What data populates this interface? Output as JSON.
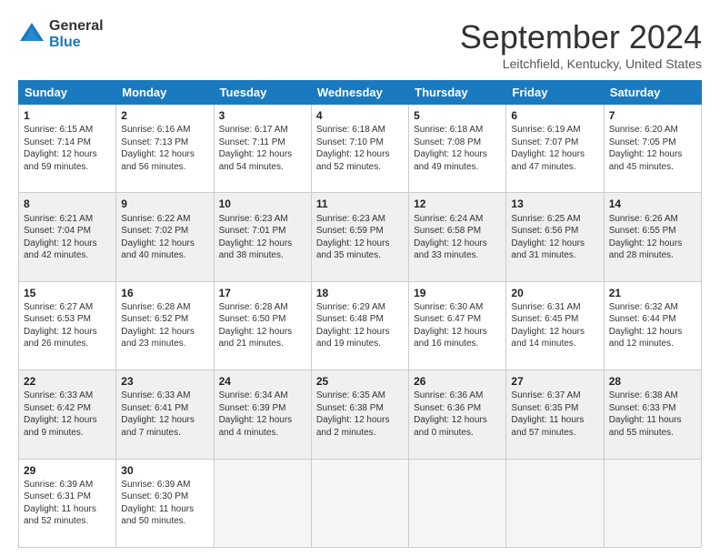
{
  "logo": {
    "line1": "General",
    "line2": "Blue"
  },
  "title": "September 2024",
  "location": "Leitchfield, Kentucky, United States",
  "headers": [
    "Sunday",
    "Monday",
    "Tuesday",
    "Wednesday",
    "Thursday",
    "Friday",
    "Saturday"
  ],
  "weeks": [
    [
      {
        "day": "1",
        "info": "Sunrise: 6:15 AM\nSunset: 7:14 PM\nDaylight: 12 hours\nand 59 minutes."
      },
      {
        "day": "2",
        "info": "Sunrise: 6:16 AM\nSunset: 7:13 PM\nDaylight: 12 hours\nand 56 minutes."
      },
      {
        "day": "3",
        "info": "Sunrise: 6:17 AM\nSunset: 7:11 PM\nDaylight: 12 hours\nand 54 minutes."
      },
      {
        "day": "4",
        "info": "Sunrise: 6:18 AM\nSunset: 7:10 PM\nDaylight: 12 hours\nand 52 minutes."
      },
      {
        "day": "5",
        "info": "Sunrise: 6:18 AM\nSunset: 7:08 PM\nDaylight: 12 hours\nand 49 minutes."
      },
      {
        "day": "6",
        "info": "Sunrise: 6:19 AM\nSunset: 7:07 PM\nDaylight: 12 hours\nand 47 minutes."
      },
      {
        "day": "7",
        "info": "Sunrise: 6:20 AM\nSunset: 7:05 PM\nDaylight: 12 hours\nand 45 minutes."
      }
    ],
    [
      {
        "day": "8",
        "info": "Sunrise: 6:21 AM\nSunset: 7:04 PM\nDaylight: 12 hours\nand 42 minutes."
      },
      {
        "day": "9",
        "info": "Sunrise: 6:22 AM\nSunset: 7:02 PM\nDaylight: 12 hours\nand 40 minutes."
      },
      {
        "day": "10",
        "info": "Sunrise: 6:23 AM\nSunset: 7:01 PM\nDaylight: 12 hours\nand 38 minutes."
      },
      {
        "day": "11",
        "info": "Sunrise: 6:23 AM\nSunset: 6:59 PM\nDaylight: 12 hours\nand 35 minutes."
      },
      {
        "day": "12",
        "info": "Sunrise: 6:24 AM\nSunset: 6:58 PM\nDaylight: 12 hours\nand 33 minutes."
      },
      {
        "day": "13",
        "info": "Sunrise: 6:25 AM\nSunset: 6:56 PM\nDaylight: 12 hours\nand 31 minutes."
      },
      {
        "day": "14",
        "info": "Sunrise: 6:26 AM\nSunset: 6:55 PM\nDaylight: 12 hours\nand 28 minutes."
      }
    ],
    [
      {
        "day": "15",
        "info": "Sunrise: 6:27 AM\nSunset: 6:53 PM\nDaylight: 12 hours\nand 26 minutes."
      },
      {
        "day": "16",
        "info": "Sunrise: 6:28 AM\nSunset: 6:52 PM\nDaylight: 12 hours\nand 23 minutes."
      },
      {
        "day": "17",
        "info": "Sunrise: 6:28 AM\nSunset: 6:50 PM\nDaylight: 12 hours\nand 21 minutes."
      },
      {
        "day": "18",
        "info": "Sunrise: 6:29 AM\nSunset: 6:48 PM\nDaylight: 12 hours\nand 19 minutes."
      },
      {
        "day": "19",
        "info": "Sunrise: 6:30 AM\nSunset: 6:47 PM\nDaylight: 12 hours\nand 16 minutes."
      },
      {
        "day": "20",
        "info": "Sunrise: 6:31 AM\nSunset: 6:45 PM\nDaylight: 12 hours\nand 14 minutes."
      },
      {
        "day": "21",
        "info": "Sunrise: 6:32 AM\nSunset: 6:44 PM\nDaylight: 12 hours\nand 12 minutes."
      }
    ],
    [
      {
        "day": "22",
        "info": "Sunrise: 6:33 AM\nSunset: 6:42 PM\nDaylight: 12 hours\nand 9 minutes."
      },
      {
        "day": "23",
        "info": "Sunrise: 6:33 AM\nSunset: 6:41 PM\nDaylight: 12 hours\nand 7 minutes."
      },
      {
        "day": "24",
        "info": "Sunrise: 6:34 AM\nSunset: 6:39 PM\nDaylight: 12 hours\nand 4 minutes."
      },
      {
        "day": "25",
        "info": "Sunrise: 6:35 AM\nSunset: 6:38 PM\nDaylight: 12 hours\nand 2 minutes."
      },
      {
        "day": "26",
        "info": "Sunrise: 6:36 AM\nSunset: 6:36 PM\nDaylight: 12 hours\nand 0 minutes."
      },
      {
        "day": "27",
        "info": "Sunrise: 6:37 AM\nSunset: 6:35 PM\nDaylight: 11 hours\nand 57 minutes."
      },
      {
        "day": "28",
        "info": "Sunrise: 6:38 AM\nSunset: 6:33 PM\nDaylight: 11 hours\nand 55 minutes."
      }
    ],
    [
      {
        "day": "29",
        "info": "Sunrise: 6:39 AM\nSunset: 6:31 PM\nDaylight: 11 hours\nand 52 minutes."
      },
      {
        "day": "30",
        "info": "Sunrise: 6:39 AM\nSunset: 6:30 PM\nDaylight: 11 hours\nand 50 minutes."
      },
      {
        "day": "",
        "info": ""
      },
      {
        "day": "",
        "info": ""
      },
      {
        "day": "",
        "info": ""
      },
      {
        "day": "",
        "info": ""
      },
      {
        "day": "",
        "info": ""
      }
    ]
  ]
}
